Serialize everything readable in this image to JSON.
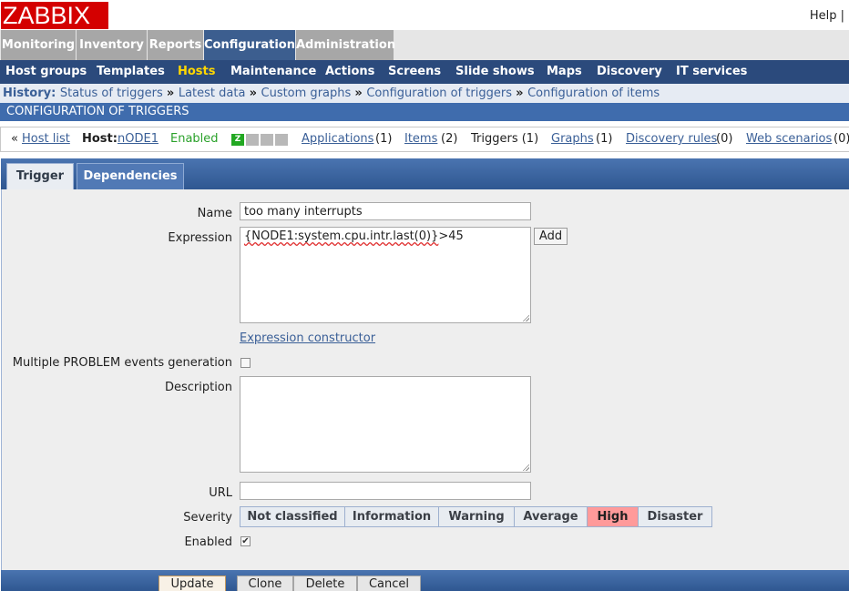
{
  "header": {
    "logo": "ZABBIX",
    "help": "Help |"
  },
  "main_menu": [
    {
      "label": "Monitoring",
      "active": false
    },
    {
      "label": "Inventory",
      "active": false
    },
    {
      "label": "Reports",
      "active": false
    },
    {
      "label": "Configuration",
      "active": true
    },
    {
      "label": "Administration",
      "active": false
    }
  ],
  "sub_menu": [
    {
      "label": "Host groups",
      "active": false
    },
    {
      "label": "Templates",
      "active": false
    },
    {
      "label": "Hosts",
      "active": true
    },
    {
      "label": "Maintenance",
      "active": false
    },
    {
      "label": "Actions",
      "active": false
    },
    {
      "label": "Screens",
      "active": false
    },
    {
      "label": "Slide shows",
      "active": false
    },
    {
      "label": "Maps",
      "active": false
    },
    {
      "label": "Discovery",
      "active": false
    },
    {
      "label": "IT services",
      "active": false
    }
  ],
  "history": {
    "label": "History:",
    "items": [
      "Status of triggers",
      "Latest data",
      "Custom graphs",
      "Configuration of triggers",
      "Configuration of items"
    ],
    "separator": "»"
  },
  "section_title": "CONFIGURATION OF TRIGGERS",
  "host_line": {
    "back_prefix": "«",
    "host_list": "Host list",
    "host_label": "Host:",
    "host_name": "nODE1",
    "status": "Enabled",
    "z_icon": "Z",
    "applications": "Applications",
    "applications_count": "(1)",
    "items": "Items",
    "items_count": "(2)",
    "triggers": "Triggers (1)",
    "graphs": "Graphs",
    "graphs_count": "(1)",
    "discovery": "Discovery rules",
    "discovery_count": "(0)",
    "web": "Web scenarios",
    "web_count": "(0)"
  },
  "tabs": [
    {
      "label": "Trigger",
      "active": true
    },
    {
      "label": "Dependencies",
      "active": false
    }
  ],
  "form": {
    "name_label": "Name",
    "name_value": "too many interrupts",
    "expression_label": "Expression",
    "expression_value": "{NODE1:system.cpu.intr.last(0)}",
    "expression_suffix": ">45",
    "add_button": "Add",
    "expression_constructor": "Expression constructor",
    "multiple_label": "Multiple PROBLEM events generation",
    "multiple_checked": false,
    "description_label": "Description",
    "description_value": "",
    "url_label": "URL",
    "url_value": "",
    "severity_label": "Severity",
    "severity_options": [
      "Not classified",
      "Information",
      "Warning",
      "Average",
      "High",
      "Disaster"
    ],
    "severity_selected": "High",
    "enabled_label": "Enabled",
    "enabled_checked": true
  },
  "footer_buttons": [
    "Update",
    "Clone",
    "Delete",
    "Cancel"
  ],
  "colors": {
    "logo_red": "#d40000",
    "menu_active": "#3c5e8f",
    "submenu_bg": "#2b4a7c",
    "hosts_active": "#ffd700",
    "link": "#3a5f97",
    "enabled_green": "#2aa12a",
    "severity_high": "#ff9a9a"
  }
}
